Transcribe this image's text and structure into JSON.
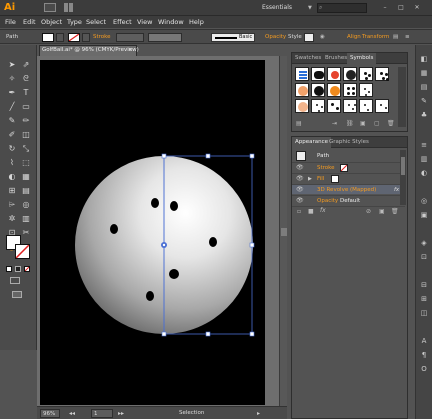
{
  "app": {
    "logo": "Ai",
    "workspace": "Essentials",
    "menu": [
      "File",
      "Edit",
      "Object",
      "Type",
      "Select",
      "Effect",
      "View",
      "Window",
      "Help"
    ],
    "window_controls": {
      "minimize": "–",
      "maximize": "□",
      "close": "✕"
    }
  },
  "controlbar": {
    "selection_label": "Path",
    "stroke_label": "Stroke",
    "brush_label": "Basic",
    "opacity_label": "Opacity",
    "style_label": "Style",
    "align_label": "Align",
    "transform_label": "Transform"
  },
  "document": {
    "tab_title": "GolfBall.ai* @ 96% (CMYK/Preview)",
    "tab_close": "×"
  },
  "statusbar": {
    "zoom": "96%",
    "artboard_number": "1",
    "status": "Selection"
  },
  "swatch_panel": {
    "tabs": [
      "Swatches",
      "Brushes",
      "Symbols"
    ],
    "active_tab": "Symbols"
  },
  "appearance_panel": {
    "tabs": [
      "Appearance",
      "Graphic Styles"
    ],
    "active_tab": "Appearance",
    "object_type": "Path",
    "rows": [
      {
        "label": "Stroke",
        "value": ""
      },
      {
        "label": "Fill",
        "value": ""
      },
      {
        "label": "3D Revolve (Mapped)",
        "value": "fx"
      },
      {
        "label": "Opacity",
        "value": "Default"
      }
    ],
    "fx_label": "fx"
  },
  "colors": {
    "accent": "#ff9a00",
    "selection": "#4a6fd4",
    "artboard": "#000000"
  },
  "icons": [
    "selection-tool",
    "direct-selection-tool",
    "magic-wand",
    "lasso",
    "pen",
    "type",
    "line",
    "rectangle",
    "paintbrush",
    "pencil",
    "blob-brush",
    "eraser",
    "rotate",
    "scale",
    "warp",
    "free-transform",
    "shape-builder",
    "perspective-grid",
    "mesh",
    "gradient",
    "eyedropper",
    "blend",
    "symbol-sprayer",
    "column-graph",
    "artboard-tool",
    "slice",
    "hand",
    "zoom"
  ]
}
